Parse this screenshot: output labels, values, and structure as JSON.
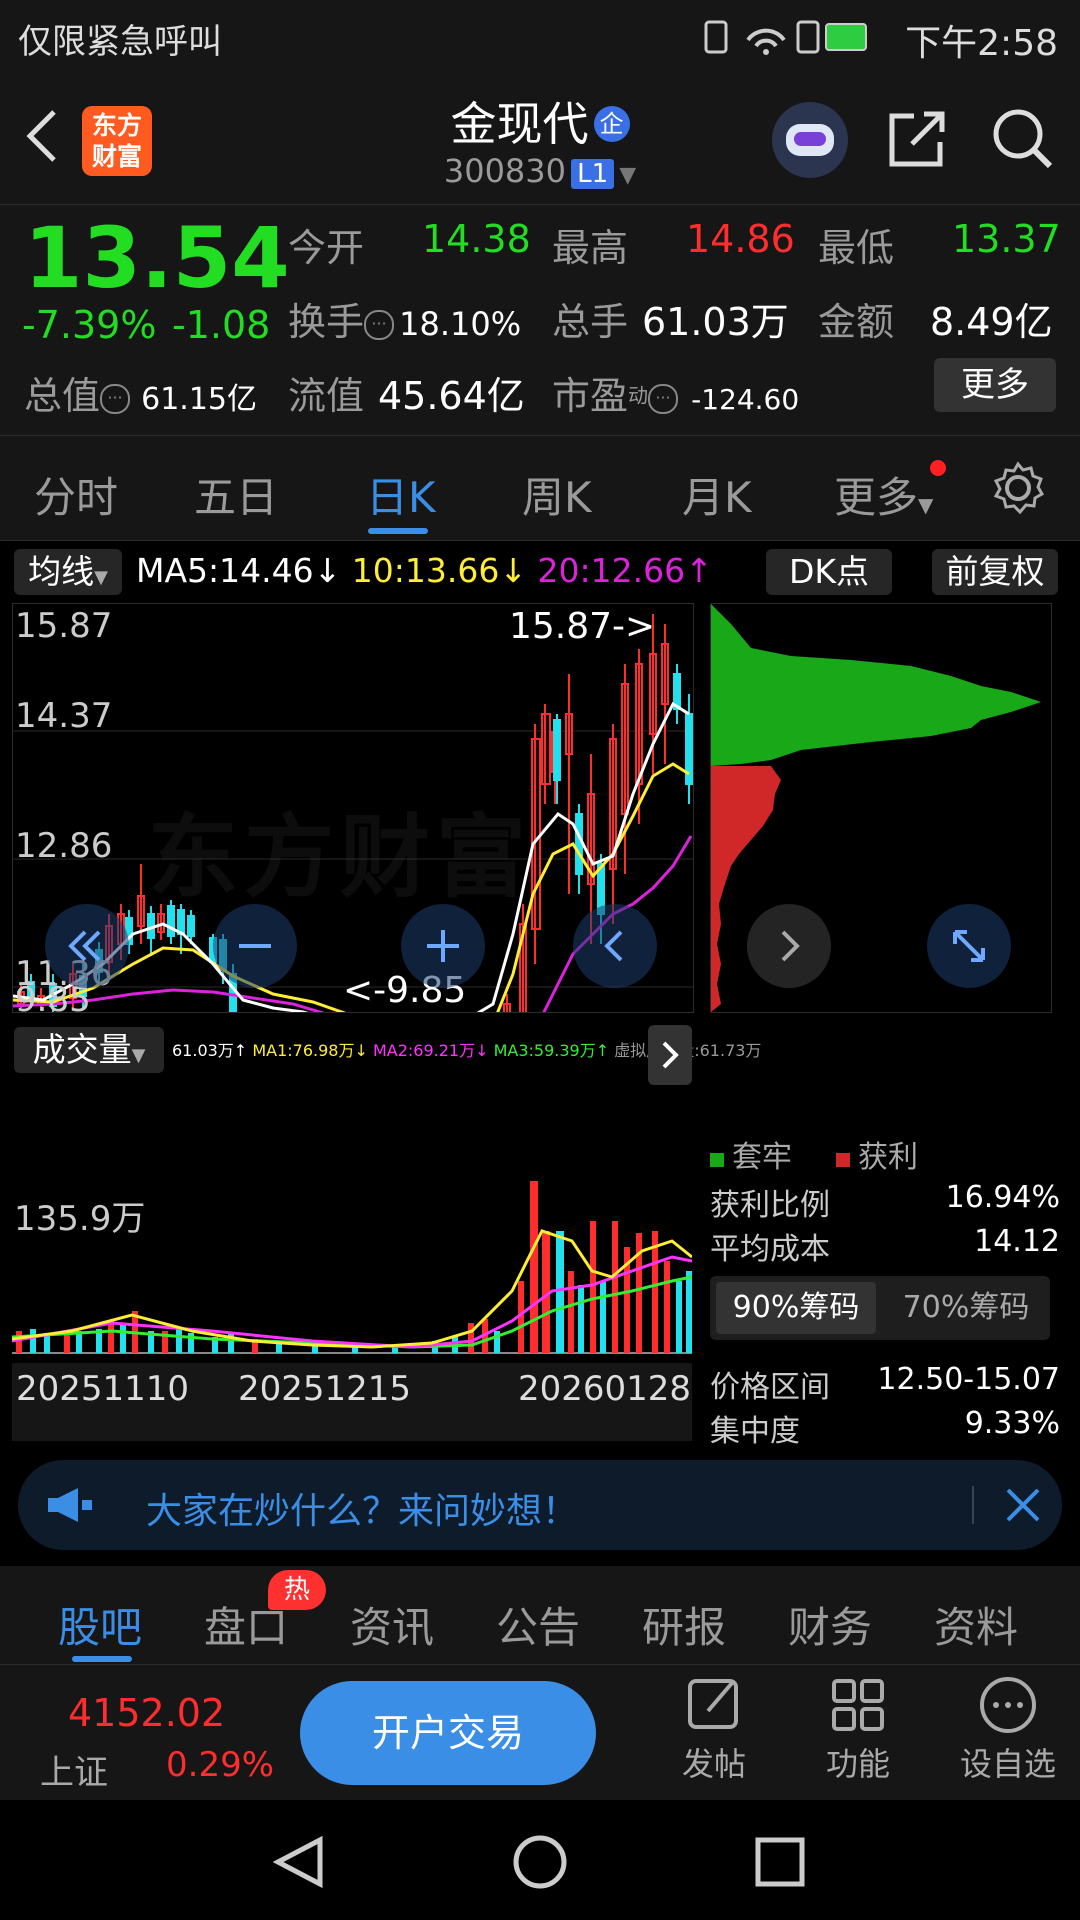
{
  "status_bar": {
    "left_text": "仅限紧急呼叫",
    "time": "下午2:58"
  },
  "header": {
    "logo_text": [
      "东方",
      "财富"
    ],
    "stock_name": "金现代",
    "badge": "企",
    "stock_code": "300830",
    "level": "L1"
  },
  "quote": {
    "price": "13.54",
    "change_pct": "-7.39%",
    "change_amt": "-1.08",
    "total_value_label": "总值",
    "total_value": "61.15亿",
    "open_label": "今开",
    "open": "14.38",
    "high_label": "最高",
    "high": "14.86",
    "low_label": "最低",
    "low": "13.37",
    "turnover_label": "换手",
    "turnover": "18.10%",
    "volume_label": "总手",
    "volume": "61.03万",
    "amount_label": "金额",
    "amount": "8.49亿",
    "float_label": "流值",
    "float_value": "45.64亿",
    "pe_label": "市盈",
    "pe_sup": "动",
    "pe": "-124.60",
    "more_label": "更多"
  },
  "period_tabs": [
    "分时",
    "五日",
    "日K",
    "周K",
    "月K",
    "更多"
  ],
  "active_tab": "日K",
  "chart_toolbar": {
    "ma_select": "均线",
    "ma5": "MA5:14.46↓",
    "ma10": "10:13.66↓",
    "ma20": "20:12.66↑",
    "dk_button": "DK点",
    "fq_button": "前复权"
  },
  "kline": {
    "y_labels": [
      "15.87",
      "14.37",
      "12.86",
      "11.36",
      "9.85"
    ],
    "high_marker": "15.87->",
    "low_marker": "<-9.85",
    "watermark": "东方财富"
  },
  "volume_panel": {
    "select": "成交量",
    "stats": [
      {
        "text": "61.03万↑",
        "color": "#ffffff"
      },
      {
        "text": "MA1:76.98万↓",
        "color": "#ffee33"
      },
      {
        "text": "MA2:69.21万↓",
        "color": "#ff33ff"
      },
      {
        "text": "MA3:59.39万↑",
        "color": "#33ee33"
      },
      {
        "text": "虚拟成交量:61.73万",
        "color": "#9a9a9a"
      }
    ],
    "max_label": "135.9万",
    "dates": [
      "20251110",
      "20251215",
      "20260128"
    ]
  },
  "chip_panel": {
    "legend_trapped": "套牢",
    "legend_profit": "获利",
    "rows": [
      {
        "label": "获利比例",
        "value": "16.94%"
      },
      {
        "label": "平均成本",
        "value": "14.12"
      }
    ],
    "tab_90": "90%筹码",
    "tab_70": "70%筹码",
    "rows2": [
      {
        "label": "价格区间",
        "value": "12.50-15.07"
      },
      {
        "label": "集中度",
        "value": "9.33%"
      }
    ]
  },
  "banner": {
    "text": "大家在炒什么？来问妙想！"
  },
  "bottom_tabs": [
    "股吧",
    "盘口",
    "资讯",
    "公告",
    "研报",
    "财务",
    "资料"
  ],
  "hot_badge": "热",
  "action_bar": {
    "index_value": "4152.02",
    "index_name": "上证",
    "index_pct": "0.29%",
    "trade_button": "开户交易",
    "actions": [
      "发帖",
      "功能",
      "设自选"
    ]
  },
  "colors": {
    "up": "#ff2d2d",
    "down": "#22dd22",
    "accent": "#3a8ee6",
    "ma5": "#ffffff",
    "ma10": "#ffee33",
    "ma20": "#dd22dd"
  }
}
